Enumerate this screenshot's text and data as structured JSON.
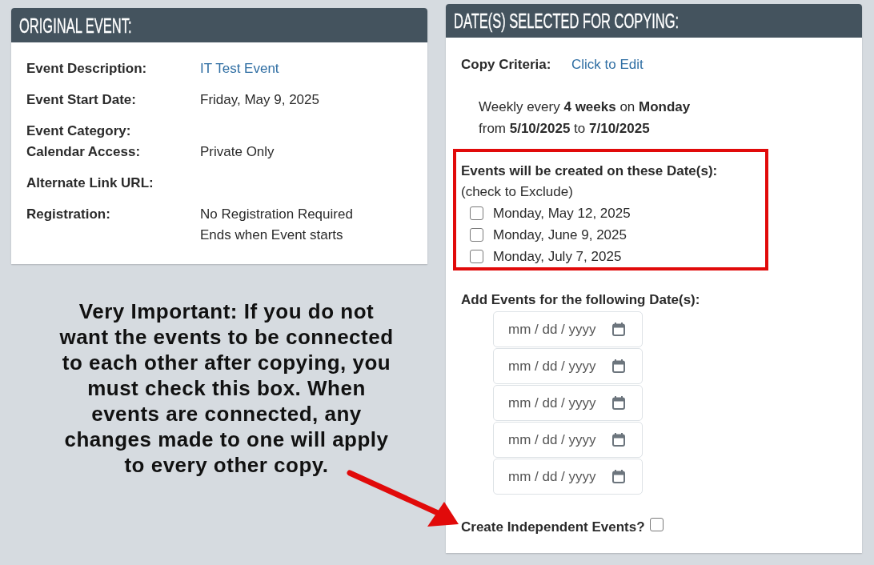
{
  "original_event": {
    "title": "ORIGINAL EVENT:",
    "field_groups": [
      {
        "fields": [
          {
            "label": "Event Description:",
            "values": [
              "IT Test Event"
            ],
            "link": true
          }
        ]
      },
      {
        "fields": [
          {
            "label": "Event Start Date:",
            "values": [
              "Friday, May 9, 2025"
            ],
            "link": false
          }
        ]
      },
      {
        "fields": [
          {
            "label": "Event Category:"
          },
          {
            "label": "Calendar Access:",
            "values": [
              "Private Only"
            ],
            "link": false
          }
        ]
      },
      {
        "fields": [
          {
            "label": "Alternate Link URL:"
          }
        ]
      },
      {
        "fields": [
          {
            "label": "Registration:",
            "values": [
              "No Registration Required",
              "Ends when Event starts"
            ],
            "link": false
          }
        ]
      }
    ]
  },
  "annotation": {
    "text_lines": [
      "Very Important: If you do not",
      "want the events to be connected",
      "to each other after copying, you",
      "must check this box. When",
      "events are connected, any",
      "changes made to one will apply",
      "to every other copy."
    ]
  },
  "copy_panel": {
    "title": "DATE(S) SELECTED FOR COPYING:",
    "criteria": {
      "label": "Copy Criteria:",
      "link": "Click to Edit"
    },
    "summary_lines": [
      "Weekly every **4 weeks** on **Monday**",
      "from **5/10/2025** to **7/10/2025**"
    ],
    "dates_box": {
      "heading": "Events will be created on these Date(s):",
      "hint": "(check to Exclude)",
      "dates": [
        {
          "label": "Monday, May 12, 2025",
          "checked": false
        },
        {
          "label": "Monday, June 9, 2025",
          "checked": false
        },
        {
          "label": "Monday, July 7, 2025",
          "checked": false
        }
      ]
    },
    "add_dates": {
      "heading": "Add Events for the following Date(s):",
      "fields": [
        {
          "placeholder": "mm / dd / yyyy"
        },
        {
          "placeholder": "mm / dd / yyyy"
        },
        {
          "placeholder": "mm / dd / yyyy"
        },
        {
          "placeholder": "mm / dd / yyyy"
        },
        {
          "placeholder": "mm / dd / yyyy"
        }
      ]
    },
    "independent": {
      "label": "Create Independent Events?",
      "checked": false
    }
  }
}
